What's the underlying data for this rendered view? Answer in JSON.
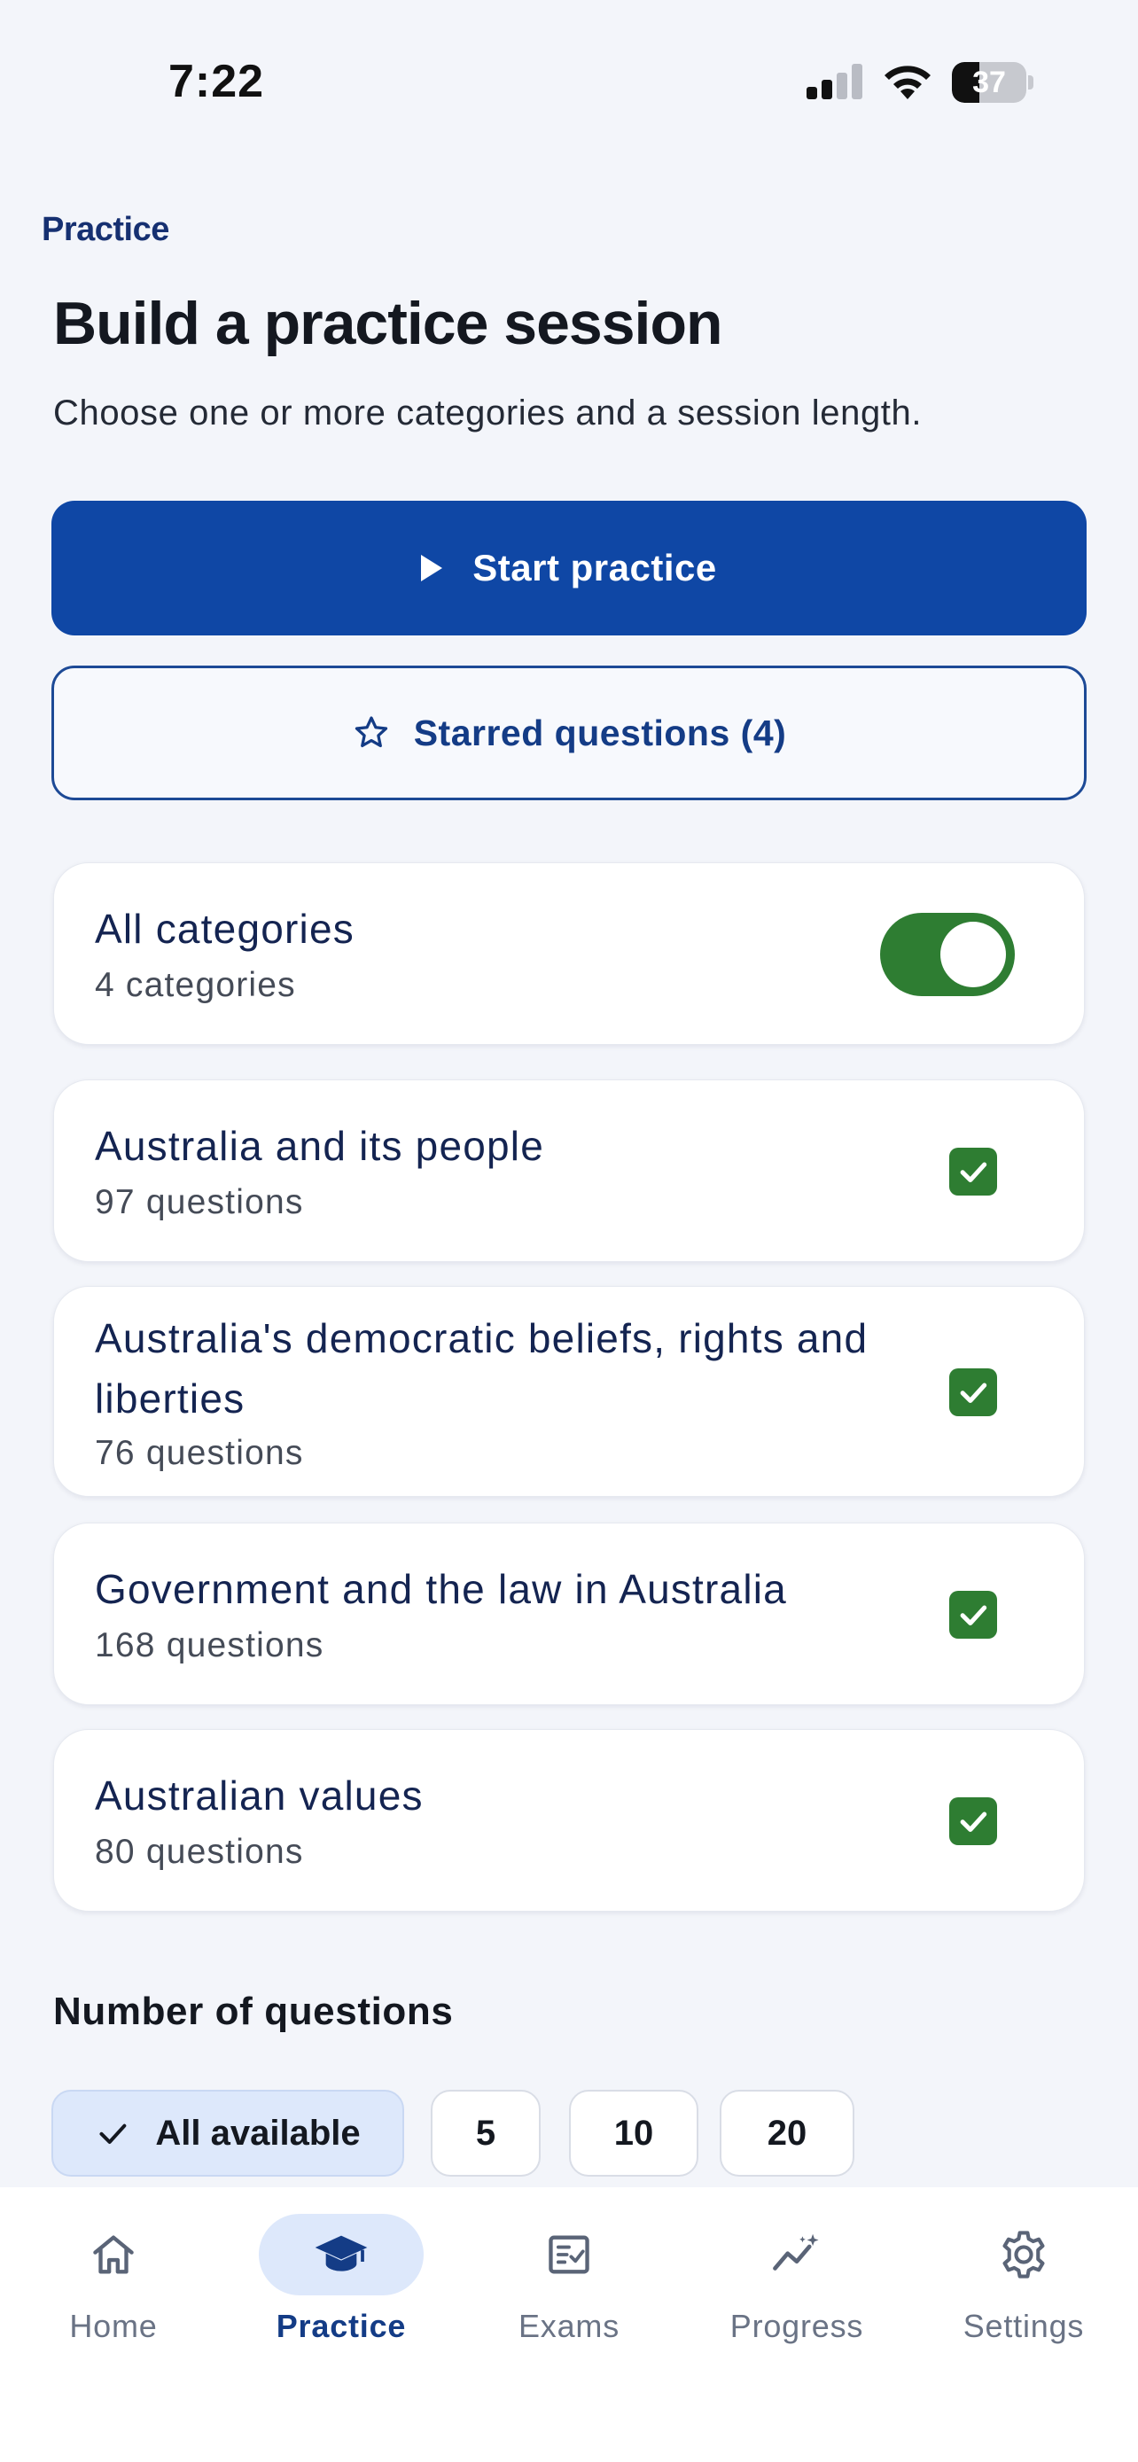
{
  "status_bar": {
    "time": "7:22",
    "battery": "37"
  },
  "header": {
    "eyebrow": "Practice",
    "title": "Build a practice session",
    "subtitle": "Choose one or more categories and a session length."
  },
  "actions": {
    "start_label": "Start practice",
    "starred_label": "Starred questions (4)"
  },
  "all_categories": {
    "title": "All categories",
    "subtitle": "4 categories",
    "enabled": true
  },
  "categories": [
    {
      "title": "Australia and its people",
      "subtitle": "97 questions",
      "checked": true
    },
    {
      "title": "Australia's democratic beliefs, rights and liberties",
      "subtitle": "76 questions",
      "checked": true
    },
    {
      "title": "Government and the law in Australia",
      "subtitle": "168 questions",
      "checked": true
    },
    {
      "title": "Australian values",
      "subtitle": "80 questions",
      "checked": true
    }
  ],
  "question_count": {
    "label": "Number of questions",
    "options": [
      "All available",
      "5",
      "10",
      "20"
    ],
    "selected": "All available"
  },
  "tabbar": {
    "items": [
      {
        "label": "Home",
        "icon": "home-icon"
      },
      {
        "label": "Practice",
        "icon": "graduation-cap-icon",
        "active": true
      },
      {
        "label": "Exams",
        "icon": "exam-checklist-icon"
      },
      {
        "label": "Progress",
        "icon": "progress-chart-icon"
      },
      {
        "label": "Settings",
        "icon": "gear-icon"
      }
    ]
  },
  "colors": {
    "primary": "#0f47a5",
    "success": "#2e7d32",
    "background": "#f3f5fa",
    "chip_selected": "#dde8fb"
  }
}
